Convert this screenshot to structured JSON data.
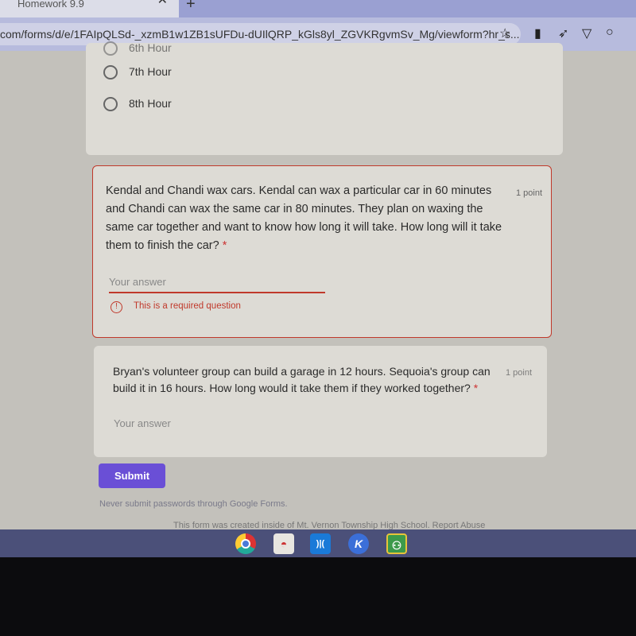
{
  "browser": {
    "tab_title": "Homework 9.9",
    "url": "com/forms/d/e/1FAIpQLSd-_xzmB1w1ZB1sUFDu-dUIlQRP_kGls8yl_ZGVKRgvmSv_Mg/viewform?hr_s..."
  },
  "prev_question": {
    "options": [
      "6th Hour",
      "7th Hour",
      "8th Hour"
    ]
  },
  "question1": {
    "text": "Kendal and Chandi wax cars. Kendal can wax a particular car in 60 minutes and Chandi can wax the same car in 80 minutes. They plan on waxing the same car together and want to know how long it will take. How long will it take them to finish the car?",
    "required_mark": "*",
    "points": "1 point",
    "placeholder": "Your answer",
    "error": "This is a required question"
  },
  "question2": {
    "text": "Bryan's volunteer group can build a garage in 12 hours. Sequoia's group can build it in 16 hours. How long would it take them if they worked together?",
    "required_mark": "*",
    "points": "1 point",
    "placeholder": "Your answer"
  },
  "submit_label": "Submit",
  "footer": {
    "warning": "Never submit passwords through Google Forms.",
    "created": "This form was created inside of Mt. Vernon Township High School. Report Abuse"
  },
  "colors": {
    "accent": "#6a4fd6",
    "error": "#c0392b"
  }
}
